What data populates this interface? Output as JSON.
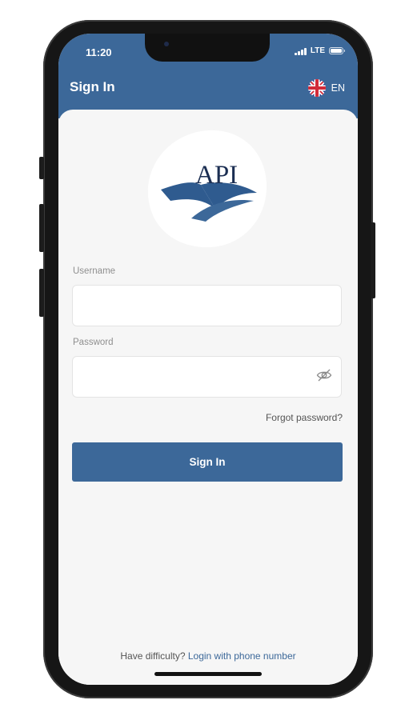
{
  "status_bar": {
    "time": "11:20",
    "network": "LTE"
  },
  "header": {
    "title": "Sign In",
    "language_code": "EN"
  },
  "logo": {
    "text": "API"
  },
  "form": {
    "username": {
      "label": "Username",
      "value": "",
      "placeholder": ""
    },
    "password": {
      "label": "Password",
      "value": "",
      "placeholder": ""
    },
    "forgot_label": "Forgot password?",
    "submit_label": "Sign In"
  },
  "footer": {
    "prompt": "Have difficulty?",
    "link_label": "Login with phone number"
  },
  "colors": {
    "brand": "#3c6899",
    "background": "#f6f6f6",
    "field_bg": "#ffffff",
    "label_text": "#8f8f8f"
  },
  "icons": [
    "uk-flag-icon",
    "eye-off-icon",
    "signal-icon",
    "battery-icon"
  ]
}
